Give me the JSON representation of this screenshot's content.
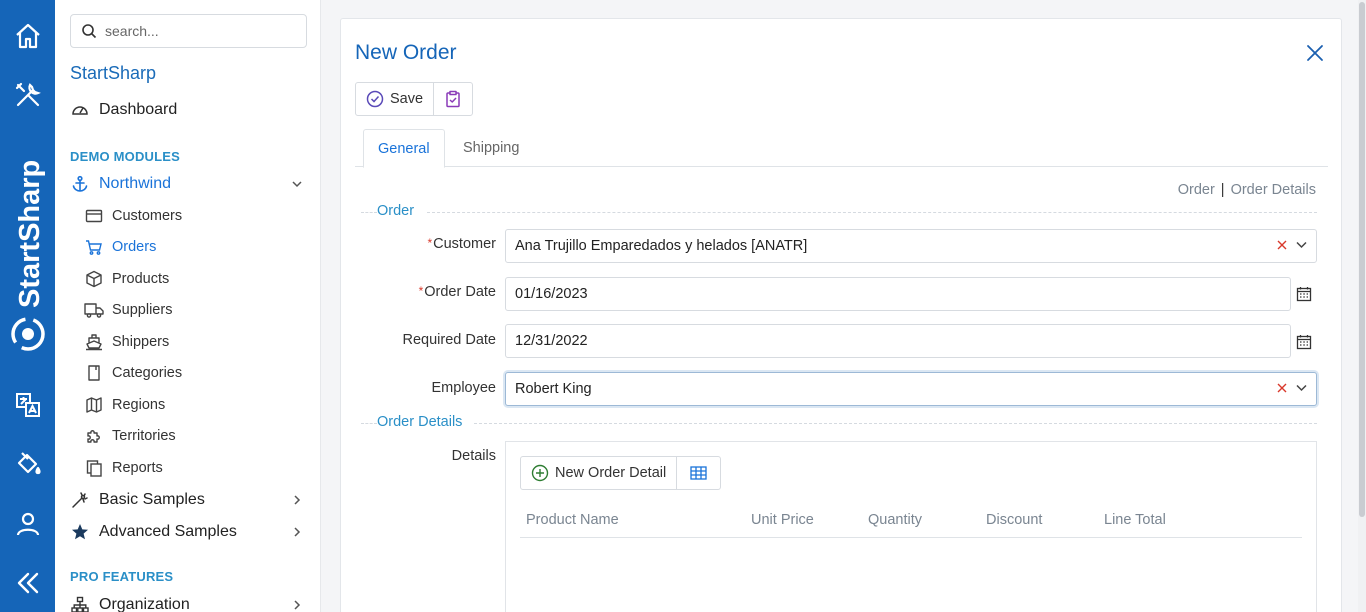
{
  "rail": {
    "brand": "StartSharp",
    "icons": [
      "home-icon",
      "tools-icon",
      "logo-icon",
      "translate-icon",
      "paint-bucket-icon",
      "user-icon",
      "collapse-icon"
    ]
  },
  "sidebar": {
    "search_placeholder": "search...",
    "brand": "StartSharp",
    "dashboard": "Dashboard",
    "section_demo": "DEMO MODULES",
    "northwind": "Northwind",
    "items": [
      {
        "label": "Customers",
        "icon": "card-icon"
      },
      {
        "label": "Orders",
        "icon": "cart-icon"
      },
      {
        "label": "Products",
        "icon": "box-icon"
      },
      {
        "label": "Suppliers",
        "icon": "truck-icon"
      },
      {
        "label": "Shippers",
        "icon": "ship-icon"
      },
      {
        "label": "Categories",
        "icon": "bookmark-icon"
      },
      {
        "label": "Regions",
        "icon": "map-icon"
      },
      {
        "label": "Territories",
        "icon": "puzzle-icon"
      },
      {
        "label": "Reports",
        "icon": "copy-icon"
      }
    ],
    "basic_samples": "Basic Samples",
    "advanced_samples": "Advanced Samples",
    "section_pro": "PRO FEATURES",
    "organization": "Organization"
  },
  "dialog": {
    "title": "New Order",
    "save_label": "Save",
    "tabs": [
      "General",
      "Shipping"
    ],
    "crumbs": [
      "Order",
      "Order Details"
    ],
    "fieldset_order": "Order",
    "fieldset_details": "Order Details",
    "fields": {
      "customer_label": "Customer",
      "customer_value": "Ana Trujillo Emparedados y helados [ANATR]",
      "order_date_label": "Order Date",
      "order_date_value": "01/16/2023",
      "required_date_label": "Required Date",
      "required_date_value": "12/31/2022",
      "employee_label": "Employee",
      "employee_value": "Robert King",
      "details_label": "Details"
    },
    "details": {
      "new_detail_label": "New Order Detail",
      "columns": [
        "Product Name",
        "Unit Price",
        "Quantity",
        "Discount",
        "Line Total"
      ]
    }
  },
  "colors": {
    "rail": "#1565b8",
    "accent": "#1a73d9",
    "section": "#2a8fc7"
  }
}
